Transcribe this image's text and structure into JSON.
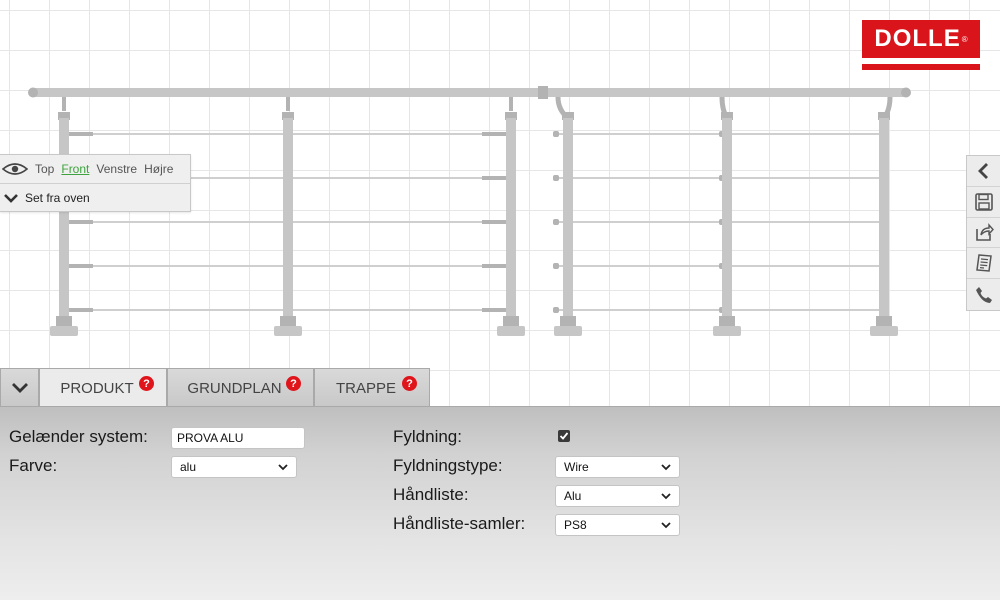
{
  "brand": {
    "logo_text": "DOLLE",
    "logo_mark": "®",
    "logo_color": "#d9141b"
  },
  "view_panel": {
    "views": [
      "Top",
      "Front",
      "Venstre",
      "Højre"
    ],
    "active_view": "Front",
    "set_label": "Set fra oven",
    "icons": [
      "eye-icon",
      "chevron-down-icon"
    ]
  },
  "toolbar": {
    "icons": [
      "chevron-left-icon",
      "save-icon",
      "share-icon",
      "document-icon",
      "phone-icon"
    ]
  },
  "tabs": {
    "items": [
      {
        "label": "PRODUKT",
        "help": "?"
      },
      {
        "label": "GRUNDPLAN",
        "help": "?"
      },
      {
        "label": "TRAPPE",
        "help": "?"
      }
    ],
    "active": "PRODUKT"
  },
  "form": {
    "system_label": "Gelænder system:",
    "system_value": "PROVA ALU",
    "color_label": "Farve:",
    "color_value": "alu",
    "infill_label": "Fyldning:",
    "infill_checked": true,
    "infill_type_label": "Fyldningstype:",
    "infill_type_value": "Wire",
    "handrail_label": "Håndliste:",
    "handrail_value": "Alu",
    "handrail_joiner_label": "Håndliste-samler:",
    "handrail_joiner_value": "PS8"
  },
  "colors": {
    "accent_green": "#3ea33e",
    "help_red": "#e0151b",
    "railing_gray": "#c6c6c6"
  }
}
